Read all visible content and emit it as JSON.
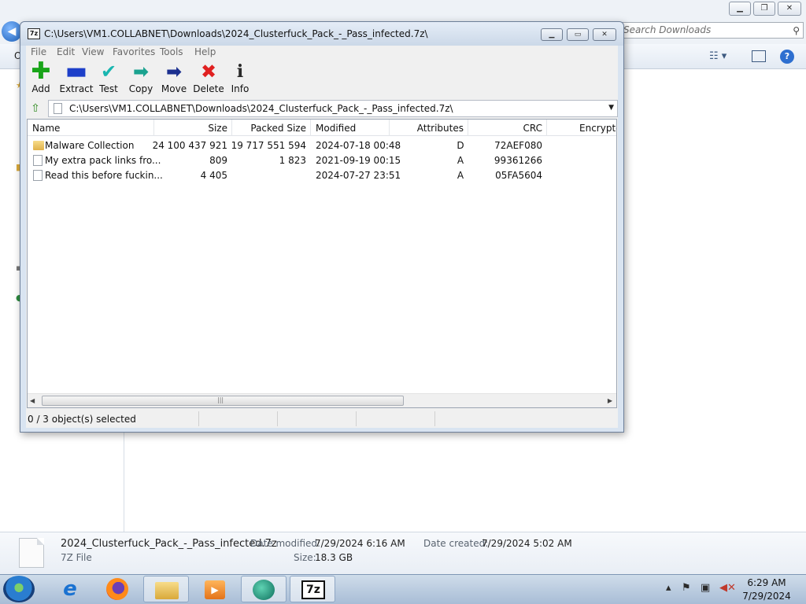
{
  "explorer": {
    "search_placeholder": "Search Downloads",
    "organize_label": "O",
    "details": {
      "file_name": "2024_Clusterfuck_Pack_-_Pass_infected.7z",
      "file_type": "7Z File",
      "date_modified_label": "Date modified:",
      "date_modified": "7/29/2024 6:16 AM",
      "date_created_label": "Date created:",
      "date_created": "7/29/2024 5:02 AM",
      "size_label": "Size:",
      "size": "18.3 GB"
    }
  },
  "sevenzip": {
    "title": "C:\\Users\\VM1.COLLABNET\\Downloads\\2024_Clusterfuck_Pack_-_Pass_infected.7z\\",
    "title_icon": "7z",
    "menu": [
      "File",
      "Edit",
      "View",
      "Favorites",
      "Tools",
      "Help"
    ],
    "toolbar": {
      "add": "Add",
      "extract": "Extract",
      "test": "Test",
      "copy": "Copy",
      "move": "Move",
      "delete": "Delete",
      "info": "Info"
    },
    "path": "C:\\Users\\VM1.COLLABNET\\Downloads\\2024_Clusterfuck_Pack_-_Pass_infected.7z\\",
    "columns": {
      "name": "Name",
      "size": "Size",
      "packed_size": "Packed Size",
      "modified": "Modified",
      "attributes": "Attributes",
      "crc": "CRC",
      "encrypted": "Encrypte"
    },
    "files": [
      {
        "name": "Malware Collection",
        "size": "24 100 437 921",
        "packed_size": "19 717 551 594",
        "modified": "2024-07-18 00:48",
        "attributes": "D",
        "crc": "72AEF080",
        "icon": "folder-icon"
      },
      {
        "name": "My extra pack links fro...",
        "size": "809",
        "packed_size": "1 823",
        "modified": "2021-09-19 00:15",
        "attributes": "A",
        "crc": "99361266",
        "icon": "document-icon"
      },
      {
        "name": "Read this before fuckin...",
        "size": "4 405",
        "packed_size": "",
        "modified": "2024-07-27 23:51",
        "attributes": "A",
        "crc": "05FA5604",
        "icon": "document-icon"
      }
    ],
    "status": "0 / 3 object(s) selected"
  },
  "taskbar": {
    "apps": [
      "internet-explorer",
      "firefox",
      "windows-explorer",
      "media-player",
      "green-app",
      "7-zip"
    ],
    "ie_glyph": "e",
    "sevenzip_glyph": "7z",
    "time": "6:29 AM",
    "date": "7/29/2024"
  }
}
